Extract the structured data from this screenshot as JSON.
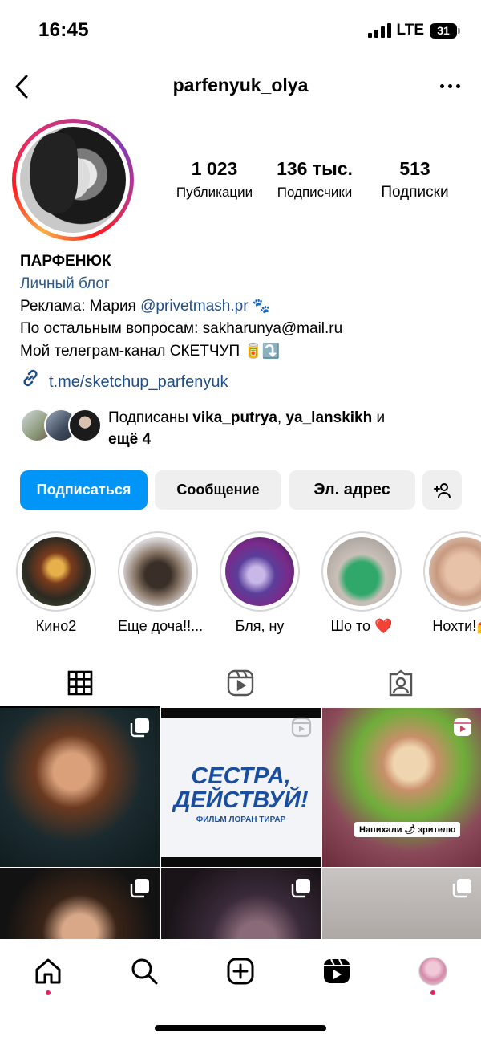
{
  "status_bar": {
    "time": "16:45",
    "network": "LTE",
    "battery": "31"
  },
  "header": {
    "username": "parfenyuk_olya"
  },
  "stats": [
    {
      "value": "1 023",
      "label": "Публикации"
    },
    {
      "value": "136 тыс.",
      "label": "Подписчики"
    },
    {
      "value": "513",
      "label": "Подписки"
    }
  ],
  "bio": {
    "name": "ПАРФЕНЮК",
    "category": "Личный блог",
    "line1_prefix": "Реклама: Мария ",
    "line1_mention": "@privetmash.pr",
    "line1_emoji": "🐾",
    "line2": "По остальным вопросам: sakharunya@mail.ru",
    "line3_text": "Мой телеграм-канал СКЕТЧУП",
    "line3_emoji": "🥫⤵️",
    "link": "t.me/sketchup_parfenyuk"
  },
  "followed_by": {
    "prefix": "Подписаны ",
    "user1": "vika_putrya",
    "separator": ", ",
    "user2": "ya_lanskikh",
    "middle": " и",
    "more": "ещё 4"
  },
  "buttons": {
    "follow": "Подписаться",
    "message": "Сообщение",
    "email": "Эл. адрес"
  },
  "highlights": [
    {
      "label": "Кино2"
    },
    {
      "label": "Еще доча!!..."
    },
    {
      "label": "Бля, ну"
    },
    {
      "label": "Шо то ❤️"
    },
    {
      "label": "Нохти!💅"
    }
  ],
  "grid": {
    "poster_title": "СЕСТРА, ДЕЙСТВУЙ!",
    "poster_subtitle": "ФИЛЬМ ЛОРАН ТИРАР",
    "caption": "Напихали 🌶 зрителю"
  },
  "colors": {
    "accent": "#0095f6",
    "link": "#1f4e8c",
    "notification_dot": "#e0245e"
  }
}
